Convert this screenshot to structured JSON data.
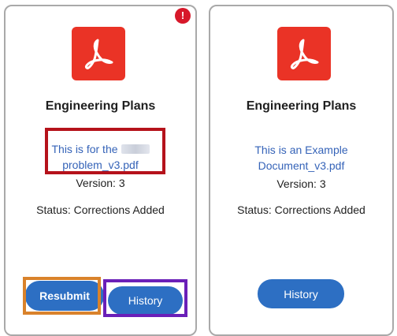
{
  "cards": [
    {
      "icon": "acrobat-pdf-icon",
      "title": "Engineering Plans",
      "file_line1": "This is for the",
      "file_line2": "problem_v3.pdf",
      "version": "Version: 3",
      "status": "Status: Corrections Added",
      "alert": "!",
      "buttons": {
        "resubmit": "Resubmit",
        "history": "History"
      }
    },
    {
      "icon": "acrobat-pdf-icon",
      "title": "Engineering Plans",
      "file_line1": "This is an Example",
      "file_line2": "Document_v3.pdf",
      "version": "Version: 3",
      "status": "Status: Corrections Added",
      "buttons": {
        "history": "History"
      }
    }
  ],
  "colors": {
    "pdf_red": "#ea3326",
    "button_blue": "#2d6fc3",
    "link_blue": "#3563b8",
    "alert_red": "#d7182a",
    "highlight_red": "#b5121b",
    "highlight_orange": "#d9822b",
    "highlight_purple": "#6a1fb8"
  }
}
